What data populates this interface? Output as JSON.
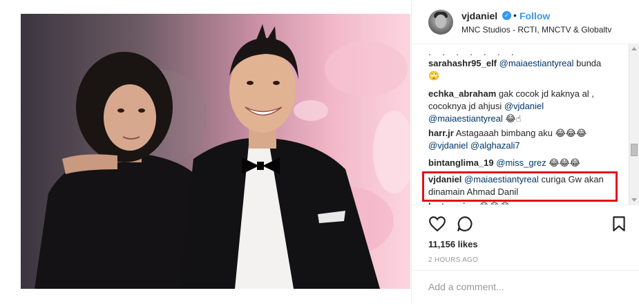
{
  "post": {
    "username": "vjdaniel",
    "verified_icon": "verified-badge-icon",
    "separator": "•",
    "follow_label": "Follow",
    "location": "MNC Studios - RCTI, MNCTV & Globaltv",
    "likes": "11,156 likes",
    "time": "2 HOURS AGO",
    "add_comment_placeholder": "Add a comment..."
  },
  "comments": [
    {
      "user": "",
      "text": "",
      "cut_line": "...",
      "mentions": []
    },
    {
      "user": "sarahashr95_elf",
      "mention": "@maiaestiantyreal",
      "text": " bunda",
      "extra": "🙄"
    },
    {
      "user": "echka_abraham",
      "text": " gak cocok jd kaknya al ,",
      "line2_pre": "cocoknya jd ahjusi ",
      "mention1": "@vjdaniel",
      "mention2": "@maiaestiantyreal",
      "extra": " 😂☝"
    },
    {
      "user": "harr.jr",
      "text": " Astagaaah bimbang aku 😂😂😂",
      "mention1": "@vjdaniel",
      "mention2": "@alghazali7"
    },
    {
      "user": "bintanglima_19",
      "mention": "@miss_grez",
      "extra": " 😂😂😂"
    },
    {
      "user": "vjdaniel",
      "mention": "@maiaestiantyreal",
      "text": " curiga Gw akan",
      "line2": "dinamain Ahmad Danil"
    },
    {
      "user": "lentera_jou",
      "extra": " 😂😂😂"
    }
  ],
  "icons": {
    "like": "heart-icon",
    "comment": "comment-icon",
    "save": "bookmark-icon"
  },
  "colors": {
    "link": "#3897f0",
    "mention": "#003569",
    "highlight_box": "#e0101d"
  }
}
